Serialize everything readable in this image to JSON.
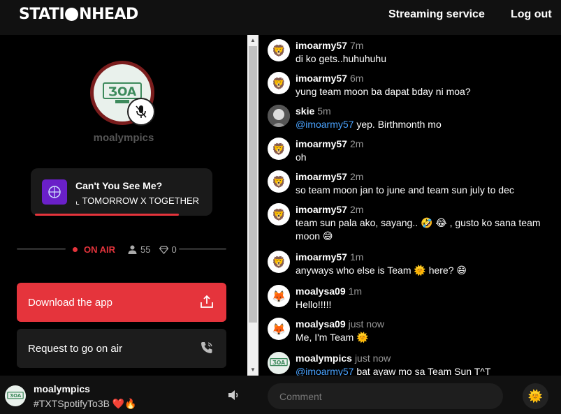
{
  "header": {
    "logo_text": "STATIONHEAD",
    "nav_streaming": "Streaming service",
    "nav_logout": "Log out"
  },
  "station": {
    "name": "moalympics",
    "logo_text": "MOA"
  },
  "song": {
    "title": "Can't You See Me?",
    "artist": "⌞ TOMORROW X TOGETHER",
    "progress_fraction": 0.83
  },
  "status": {
    "on_air": "ON AIR",
    "listeners": "55",
    "diamonds": "0"
  },
  "buttons": {
    "download": "Download the app",
    "request": "Request to go on air"
  },
  "chat": {
    "messages": [
      {
        "user": "imoarmy57",
        "time": "7m",
        "text": "di ko gets..huhuhuhu",
        "avatar": "lion"
      },
      {
        "user": "imoarmy57",
        "time": "6m",
        "text": "yung team moon ba dapat bday ni moa?",
        "avatar": "lion"
      },
      {
        "user": "skie",
        "time": "5m",
        "mention": "@imoarmy57",
        "text": " yep. Birthmonth mo",
        "avatar": "skie"
      },
      {
        "user": "imoarmy57",
        "time": "2m",
        "text": "oh",
        "avatar": "lion"
      },
      {
        "user": "imoarmy57",
        "time": "2m",
        "text": "so team moon jan to june and team sun july to dec",
        "avatar": "lion"
      },
      {
        "user": "imoarmy57",
        "time": "2m",
        "text": "team sun pala ako, sayang.. 🤣 😂 , gusto ko sana team moon 😅",
        "avatar": "lion"
      },
      {
        "user": "imoarmy57",
        "time": "1m",
        "text": "anyways who else is Team 🌞 here? 😄",
        "avatar": "lion"
      },
      {
        "user": "moalysa09",
        "time": "1m",
        "text": "Hello!!!!!",
        "avatar": "fox"
      },
      {
        "user": "moalysa09",
        "time": "just now",
        "text": "Me, I'm Team 🌞",
        "avatar": "fox"
      },
      {
        "user": "moalympics",
        "time": "just now",
        "mention": "@imoarmy57",
        "text": " bat ayaw mo sa Team Sun T^T",
        "avatar": "moa"
      }
    ]
  },
  "now_playing": {
    "name": "moalympics",
    "subtitle": "#TXTSpotifyTo3B ❤️🔥"
  },
  "comment": {
    "placeholder": "Comment",
    "emoji": "🌞"
  },
  "colors": {
    "accent": "#e5343c",
    "mention": "#4aa3ff",
    "background": "#000000"
  }
}
